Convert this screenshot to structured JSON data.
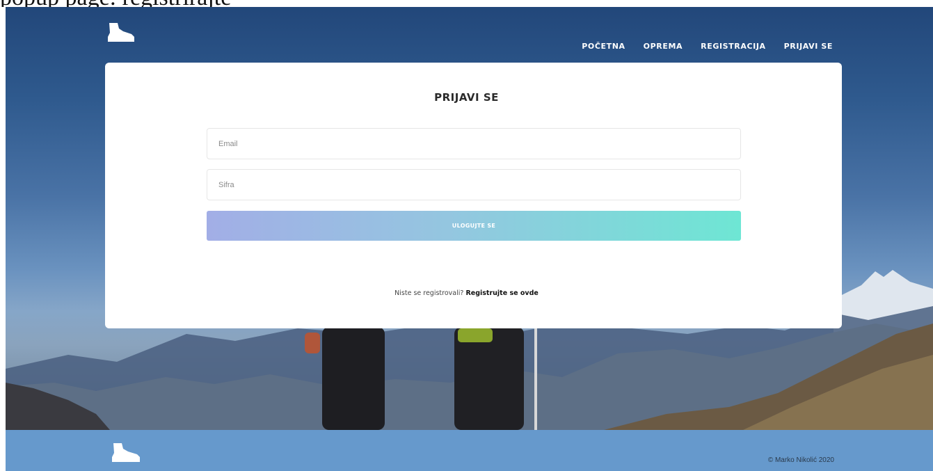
{
  "top_strip": {
    "text": "popup page: registrirajte"
  },
  "nav": {
    "logo_icon": "hiking-boot-icon",
    "items": [
      {
        "label": "POČETNA"
      },
      {
        "label": "OPREMA"
      },
      {
        "label": "REGISTRACIJA"
      },
      {
        "label": "PRIJAVI SE"
      }
    ]
  },
  "login": {
    "title": "PRIJAVI SE",
    "email_placeholder": "Email",
    "password_placeholder": "Sifra",
    "submit_label": "ULOGUJTE SE",
    "register_prompt": "Niste se registrovali?",
    "register_link": "Registrujte se ovde"
  },
  "footer": {
    "logo_icon": "hiking-boot-icon",
    "copyright": "© Marko Nikolić 2020"
  },
  "colors": {
    "footer_bg": "#6699cc",
    "button_gradient_start": "#a2aee6",
    "button_gradient_end": "#6ee6d4"
  }
}
